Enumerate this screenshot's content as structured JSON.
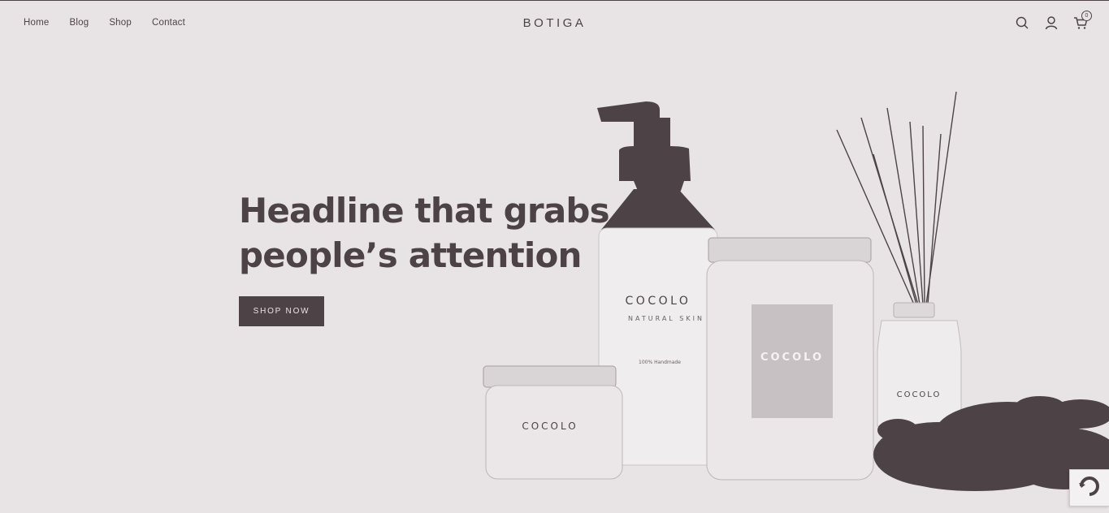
{
  "nav": {
    "items": [
      {
        "label": "Home"
      },
      {
        "label": "Blog"
      },
      {
        "label": "Shop"
      },
      {
        "label": "Contact"
      }
    ]
  },
  "logo": "BOTIGA",
  "header_icons": {
    "search": "search-icon",
    "account": "user-icon",
    "cart": "cart-icon",
    "cart_count": "0"
  },
  "hero": {
    "title": "Headline that grabs people’s attention",
    "button": "SHOP NOW"
  },
  "products": {
    "brand": "COCOLO",
    "pump_bottle_subtitle": "NATURAL SKIN",
    "pump_bottle_note": "100% Handmade"
  },
  "colors": {
    "background": "#e8e4e6",
    "primary": "#4d4346"
  }
}
